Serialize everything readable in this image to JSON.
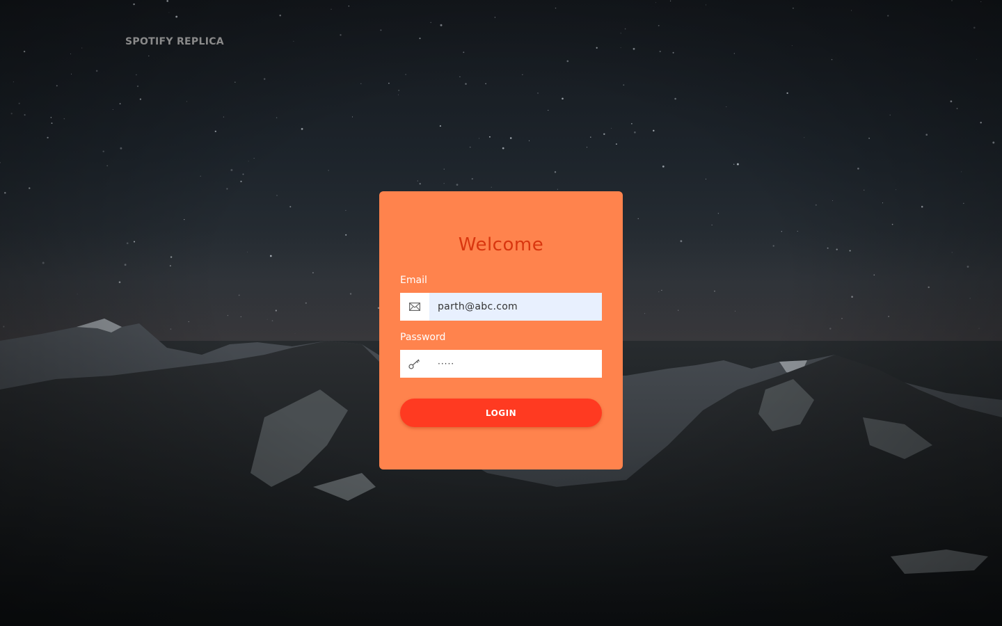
{
  "brand": {
    "name": "SPOTIFY REPLICA"
  },
  "login_card": {
    "title": "Welcome",
    "email": {
      "label": "Email",
      "value": "parth@abc.com",
      "icon": "envelope-icon"
    },
    "password": {
      "label": "Password",
      "value": "·····",
      "icon": "key-icon"
    },
    "login_button": "LOGIN"
  },
  "colors": {
    "card_background": "#ff834d",
    "title": "#d9360f",
    "button": "#ff3a21",
    "email_autofill": "#e8f0fe"
  }
}
